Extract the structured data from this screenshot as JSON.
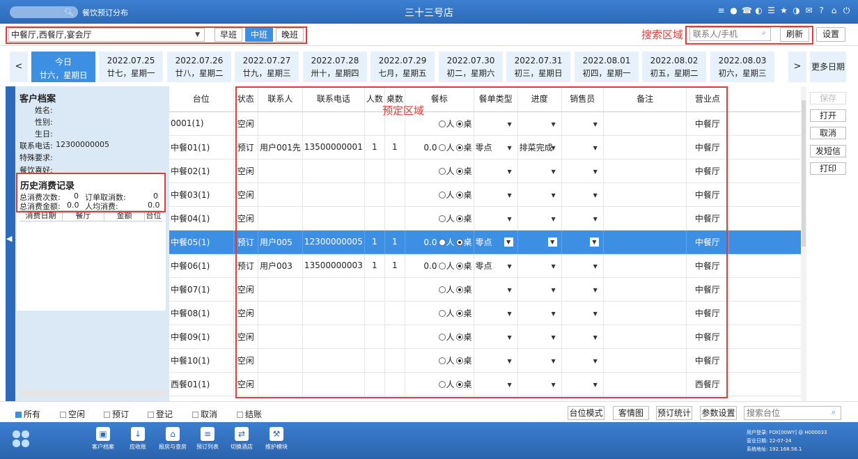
{
  "titlebar": {
    "module_title": "餐饮预订分布",
    "store_name": "三十三号店",
    "icons": [
      "wifi-icon",
      "chat-icon",
      "phone-icon",
      "palette-icon",
      "menu-icon",
      "star-icon",
      "contrast-icon",
      "mail-icon",
      "help-icon",
      "home-icon",
      "power-icon"
    ]
  },
  "toolbar": {
    "hall_select": "中餐厅,西餐厅,宴会厅",
    "shifts": [
      "早班",
      "中班",
      "晚班"
    ],
    "active_shift": "中班",
    "search_area_label": "搜索区域",
    "contact_placeholder": "联系人/手机",
    "refresh": "刷新",
    "settings": "设置"
  },
  "dates": [
    {
      "d": "今日",
      "w": "廿六，星期日"
    },
    {
      "d": "2022.07.25",
      "w": "廿七，星期一"
    },
    {
      "d": "2022.07.26",
      "w": "廿八，星期二"
    },
    {
      "d": "2022.07.27",
      "w": "廿九，星期三"
    },
    {
      "d": "2022.07.28",
      "w": "卅十，星期四"
    },
    {
      "d": "2022.07.29",
      "w": "七月，星期五"
    },
    {
      "d": "2022.07.30",
      "w": "初二，星期六"
    },
    {
      "d": "2022.07.31",
      "w": "初三，星期日"
    },
    {
      "d": "2022.08.01",
      "w": "初四，星期一"
    },
    {
      "d": "2022.08.02",
      "w": "初五，星期二"
    },
    {
      "d": "2022.08.03",
      "w": "初六，星期三"
    }
  ],
  "date_nav": {
    "prev": "<",
    "next": ">",
    "more": "更多日期"
  },
  "customer": {
    "title": "客户档案",
    "name_label": "姓名:",
    "gender_label": "性别:",
    "birthday_label": "生日:",
    "phone_label": "联系电话:",
    "phone_value": "12300000005",
    "special_label": "特殊要求:",
    "pref_label": "餐饮喜好:",
    "history_title": "历史消费记录",
    "total_count_label": "总消费次数:",
    "total_count": "0",
    "cancel_count_label": "订单取消数:",
    "cancel_count": "0",
    "total_amount_label": "总消费金额:",
    "total_amount": "0.0",
    "avg_label": "人均消费:",
    "avg_value": "0.0",
    "history_cols": [
      "消费日期",
      "餐厅",
      "金额",
      "台位"
    ]
  },
  "table": {
    "booking_area_label": "预定区域",
    "headers": [
      "台位",
      "状态",
      "联系人",
      "联系电话",
      "人数",
      "桌数",
      "餐标",
      "餐单类型",
      "进度",
      "销售员",
      "备注",
      "营业点"
    ],
    "radio_person": "人",
    "radio_table": "桌",
    "rows": [
      {
        "seat": "0001(1)",
        "status": "空闲",
        "contact": "",
        "phone": "",
        "people": "",
        "tables": "",
        "std": "",
        "menu": "",
        "progress": "",
        "sales": "",
        "note": "",
        "outlet": "中餐厅",
        "sel": false
      },
      {
        "seat": "中餐01(1)",
        "status": "预订",
        "contact": "用户001先",
        "phone": "13500000001",
        "people": "1",
        "tables": "1",
        "std": "0.0",
        "menu": "零点",
        "progress": "排菜完成",
        "sales": "",
        "note": "",
        "outlet": "中餐厅",
        "sel": false
      },
      {
        "seat": "中餐02(1)",
        "status": "空闲",
        "contact": "",
        "phone": "",
        "people": "",
        "tables": "",
        "std": "",
        "menu": "",
        "progress": "",
        "sales": "",
        "note": "",
        "outlet": "中餐厅",
        "sel": false
      },
      {
        "seat": "中餐03(1)",
        "status": "空闲",
        "contact": "",
        "phone": "",
        "people": "",
        "tables": "",
        "std": "",
        "menu": "",
        "progress": "",
        "sales": "",
        "note": "",
        "outlet": "中餐厅",
        "sel": false
      },
      {
        "seat": "中餐04(1)",
        "status": "空闲",
        "contact": "",
        "phone": "",
        "people": "",
        "tables": "",
        "std": "",
        "menu": "",
        "progress": "",
        "sales": "",
        "note": "",
        "outlet": "中餐厅",
        "sel": false
      },
      {
        "seat": "中餐05(1)",
        "status": "预订",
        "contact": "用户005",
        "phone": "12300000005",
        "people": "1",
        "tables": "1",
        "std": "0.0",
        "menu": "零点",
        "progress": "",
        "sales": "",
        "note": "",
        "outlet": "中餐厅",
        "sel": true
      },
      {
        "seat": "中餐06(1)",
        "status": "预订",
        "contact": "用户003",
        "phone": "13500000003",
        "people": "1",
        "tables": "1",
        "std": "0.0",
        "menu": "零点",
        "progress": "",
        "sales": "",
        "note": "",
        "outlet": "中餐厅",
        "sel": false
      },
      {
        "seat": "中餐07(1)",
        "status": "空闲",
        "contact": "",
        "phone": "",
        "people": "",
        "tables": "",
        "std": "",
        "menu": "",
        "progress": "",
        "sales": "",
        "note": "",
        "outlet": "中餐厅",
        "sel": false
      },
      {
        "seat": "中餐08(1)",
        "status": "空闲",
        "contact": "",
        "phone": "",
        "people": "",
        "tables": "",
        "std": "",
        "menu": "",
        "progress": "",
        "sales": "",
        "note": "",
        "outlet": "中餐厅",
        "sel": false
      },
      {
        "seat": "中餐09(1)",
        "status": "空闲",
        "contact": "",
        "phone": "",
        "people": "",
        "tables": "",
        "std": "",
        "menu": "",
        "progress": "",
        "sales": "",
        "note": "",
        "outlet": "中餐厅",
        "sel": false
      },
      {
        "seat": "中餐10(1)",
        "status": "空闲",
        "contact": "",
        "phone": "",
        "people": "",
        "tables": "",
        "std": "",
        "menu": "",
        "progress": "",
        "sales": "",
        "note": "",
        "outlet": "中餐厅",
        "sel": false
      },
      {
        "seat": "西餐01(1)",
        "status": "空闲",
        "contact": "",
        "phone": "",
        "people": "",
        "tables": "",
        "std": "",
        "menu": "",
        "progress": "",
        "sales": "",
        "note": "",
        "outlet": "西餐厅",
        "sel": false
      }
    ]
  },
  "side_buttons": [
    "保存",
    "打开",
    "取消",
    "发短信",
    "打印"
  ],
  "filters": [
    {
      "label": "所有",
      "checked": true
    },
    {
      "label": "空闲",
      "checked": false
    },
    {
      "label": "预订",
      "checked": false
    },
    {
      "label": "登记",
      "checked": false
    },
    {
      "label": "取消",
      "checked": false
    },
    {
      "label": "结账",
      "checked": false
    }
  ],
  "filter_buttons": [
    "台位模式",
    "客情图",
    "预订统计",
    "参数设置"
  ],
  "table_search_placeholder": "搜索台位",
  "modules": [
    "客户档案",
    "应收账",
    "报房与查房",
    "预订列表",
    "切换酒店",
    "维护模块"
  ],
  "login": {
    "user": "用户登录:  FOX[00WY] @ H000033",
    "date": "营业日期:  22-07-24",
    "addr": "系统地址:  192.168.56.1"
  },
  "colors": {
    "accent": "#3d8fe3",
    "bar": "#2d6ab8",
    "annotation": "#e53935",
    "panel": "#dbe9f6"
  }
}
